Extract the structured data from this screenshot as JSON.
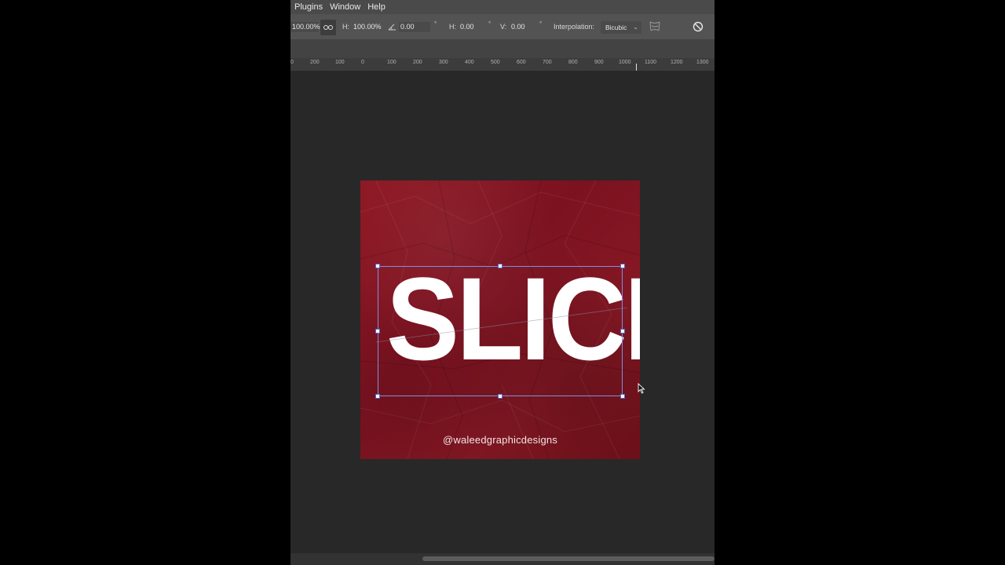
{
  "menu": {
    "items": [
      "Plugins",
      "Window",
      "Help"
    ]
  },
  "options": {
    "width_value": "100.00%",
    "height_label": "H:",
    "height_value": "100.00%",
    "angle_value": "0.00",
    "angle_unit": "°",
    "skew_h_label": "H:",
    "skew_h_value": "0.00",
    "skew_h_unit": "°",
    "skew_v_label": "V:",
    "skew_v_value": "0.00",
    "skew_v_unit": "°",
    "interpolation_label": "Interpolation:",
    "interpolation_value": "Bicubic"
  },
  "ruler": {
    "labels": [
      "0",
      "200",
      "100",
      "0",
      "100",
      "200",
      "300",
      "400",
      "500",
      "600",
      "700",
      "800",
      "900",
      "1000",
      "1100",
      "1200",
      "1300"
    ]
  },
  "canvas": {
    "headline": "SLICE",
    "handle": "@waleedgraphicdesigns",
    "background_color": "#8a1622"
  },
  "icons": {
    "link": "link-icon",
    "angle": "angle-icon",
    "warp": "warp-icon",
    "cancel": "cancel-icon",
    "cursor": "pointer-cursor-icon"
  }
}
